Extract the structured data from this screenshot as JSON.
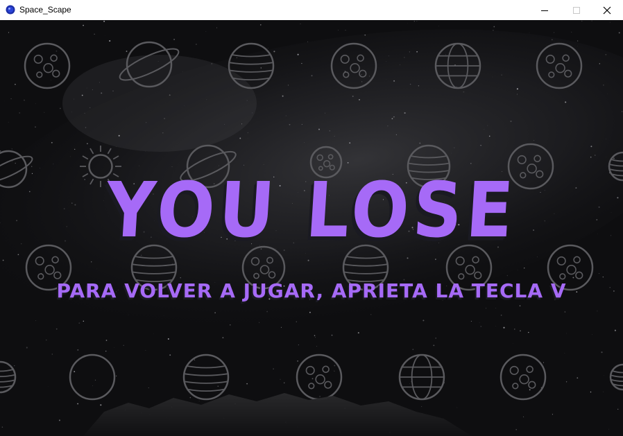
{
  "window": {
    "title": "Space_Scape",
    "controls": [
      "minimize-icon",
      "maximize-icon",
      "close-icon"
    ]
  },
  "game": {
    "title_text": "YOU LOSE",
    "hint_text": "PARA VOLVER A JUGAR, APRIETA LA TECLA V",
    "colors": {
      "text": "#a66af7",
      "text_shadow": "#1a1a22",
      "background": "#0e0e10",
      "planet_outline": "#5a5a5e",
      "app_icon": "#1d2fa8"
    }
  }
}
